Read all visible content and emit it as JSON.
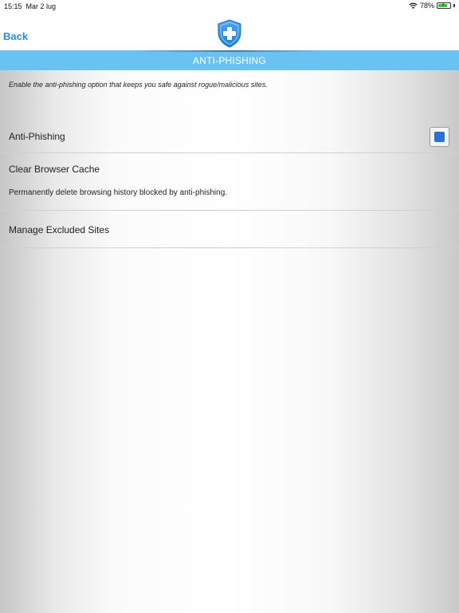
{
  "status_bar": {
    "time": "15:15",
    "date": "Mar 2 lug",
    "battery": "78%",
    "battery_level": 0.78,
    "icons": [
      "wifi-icon",
      "battery-icon"
    ]
  },
  "nav": {
    "back_label": "Back",
    "logo_icon": "shield-plus-icon"
  },
  "title_bar": {
    "title": "ANTI-PHISHING"
  },
  "content": {
    "description": "Enable the anti-phishing option that keeps you safe against rogue/malicious sites.",
    "anti_phishing": {
      "label": "Anti-Phishing",
      "checked": true
    },
    "clear_cache": {
      "label": "Clear Browser Cache",
      "subtitle": "Permanently delete browsing history blocked by anti-phishing."
    },
    "manage_excluded": {
      "label": "Manage Excluded Sites"
    }
  },
  "colors": {
    "accent": "#2a8de0",
    "title_bar": "#6ac2f3",
    "checkbox_fill": "#2a72d6"
  }
}
